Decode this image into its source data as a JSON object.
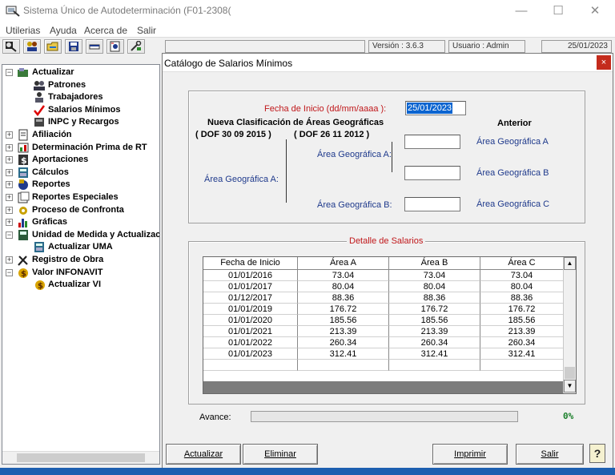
{
  "window": {
    "title": "Sistema Único de Autodeterminación (F01-2308(",
    "controls": {
      "minimize": "—",
      "maximize": "☐",
      "close": "✕"
    }
  },
  "menu": [
    "Utilerias",
    "Ayuda",
    "Acerca de",
    "Salir"
  ],
  "status": {
    "version": "Versión : 3.6.3",
    "user": "Usuario : Admin",
    "date": "25/01/2023"
  },
  "tree": [
    {
      "label": "Actualizar",
      "level": 0,
      "expander": "−",
      "icon": "update-folder-icon"
    },
    {
      "label": "Patrones",
      "level": 1,
      "icon": "employers-icon"
    },
    {
      "label": "Trabajadores",
      "level": 1,
      "icon": "workers-icon"
    },
    {
      "label": "Salarios Mínimos",
      "level": 1,
      "icon": "checkmark-icon"
    },
    {
      "label": "INPC y Recargos",
      "level": 1,
      "icon": "inpc-icon"
    },
    {
      "label": "Afiliación",
      "level": 0,
      "expander": "+",
      "icon": "document-icon"
    },
    {
      "label": "Determinación Prima de RT",
      "level": 0,
      "expander": "+",
      "icon": "report-icon"
    },
    {
      "label": "Aportaciones",
      "level": 0,
      "expander": "+",
      "icon": "dollar-icon"
    },
    {
      "label": "Cálculos",
      "level": 0,
      "expander": "+",
      "icon": "calculator-icon"
    },
    {
      "label": "Reportes",
      "level": 0,
      "expander": "+",
      "icon": "reports-icon"
    },
    {
      "label": "Reportes Especiales",
      "level": 0,
      "expander": "+",
      "icon": "special-reports-icon"
    },
    {
      "label": "Proceso de Confronta",
      "level": 0,
      "expander": "+",
      "icon": "process-icon"
    },
    {
      "label": "Gráficas",
      "level": 0,
      "expander": "+",
      "icon": "bar-chart-icon"
    },
    {
      "label": "Unidad de Medida y Actualizac",
      "level": 0,
      "expander": "−",
      "icon": "uma-icon"
    },
    {
      "label": "Actualizar UMA",
      "level": 1,
      "icon": "calculator-icon"
    },
    {
      "label": "Registro de Obra",
      "level": 0,
      "expander": "+",
      "icon": "tools-icon"
    },
    {
      "label": "Valor INFONAVIT",
      "level": 0,
      "expander": "−",
      "icon": "infonavit-icon"
    },
    {
      "label": "Actualizar VI",
      "level": 1,
      "icon": "coin-icon"
    }
  ],
  "dialog": {
    "title": "Catálogo de Salarios Mínimos",
    "close": "×",
    "fecha_label": "Fecha de Inicio (dd/mm/aaaa ):",
    "fecha_value": "25/01/2023",
    "nueva_title": "Nueva Clasificación de Áreas Geográficas",
    "dof_2015": "( DOF 30 09 2015 )",
    "dof_2012": "( DOF 26 11 2012 )",
    "anterior": "Anterior",
    "area_a_left": "Área Geográfica A:",
    "area_a_mid": "Área Geográfica A:",
    "area_b_mid": "Área Geográfica B:",
    "anterior_a": "Área Geográfica A",
    "anterior_b": "Área Geográfica B",
    "anterior_c": "Área Geográfica C",
    "detalle_title": "Detalle de Salarios",
    "columns": [
      "Fecha de Inicio",
      "Área A",
      "Área B",
      "Área C"
    ],
    "rows": [
      [
        "01/01/2016",
        "73.04",
        "73.04",
        "73.04"
      ],
      [
        "01/01/2017",
        "80.04",
        "80.04",
        "80.04"
      ],
      [
        "01/12/2017",
        "88.36",
        "88.36",
        "88.36"
      ],
      [
        "01/01/2019",
        "176.72",
        "176.72",
        "176.72"
      ],
      [
        "01/01/2020",
        "185.56",
        "185.56",
        "185.56"
      ],
      [
        "01/01/2021",
        "213.39",
        "213.39",
        "213.39"
      ],
      [
        "01/01/2022",
        "260.34",
        "260.34",
        "260.34"
      ],
      [
        "01/01/2023",
        "312.41",
        "312.41",
        "312.41"
      ]
    ],
    "avance_label": "Avance:",
    "avance_pct": "0%",
    "avance_value": 0,
    "buttons": {
      "actualizar": "Actualizar",
      "eliminar": "Eliminar",
      "imprimir": "Imprimir",
      "salir": "Salir",
      "help": "?"
    }
  },
  "colors": {
    "accent_red": "#c0171a",
    "label_blue": "#1f3a8c",
    "selection": "#0b64d0",
    "progress_green": "#1a7f2a"
  }
}
